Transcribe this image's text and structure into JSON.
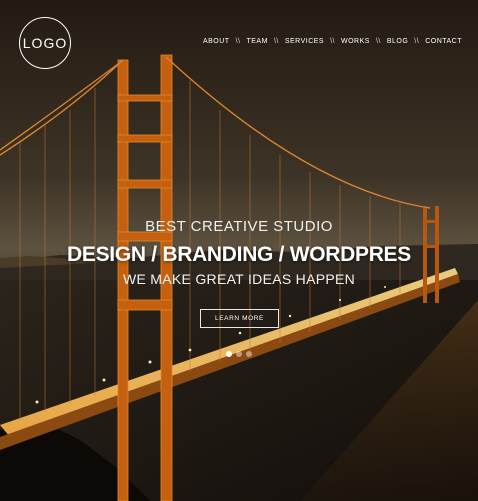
{
  "header": {
    "logo_text": "LOGO",
    "nav": [
      {
        "label": "ABOUT"
      },
      {
        "label": "TEAM"
      },
      {
        "label": "SERVICES"
      },
      {
        "label": "WORKS"
      },
      {
        "label": "BLOG"
      },
      {
        "label": "CONTACT"
      }
    ],
    "separator": "\\\\"
  },
  "hero": {
    "tagline": "BEST CREATIVE STUDIO",
    "headline": "DESIGN / BRANDING / WORDPRES",
    "subline": "WE MAKE GREAT IDEAS HAPPEN",
    "button_label": "LEARN MORE"
  },
  "slider": {
    "dot_count": 3,
    "active_index": 0
  },
  "colors": {
    "sky_top": "#2a2018",
    "sky_glow": "#6b5a40",
    "bridge_orange": "#d46a14",
    "water": "#1e1a16"
  }
}
